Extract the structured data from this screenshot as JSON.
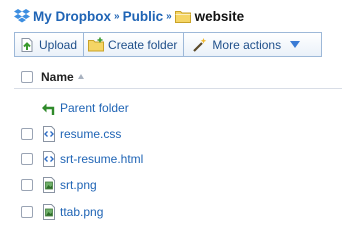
{
  "breadcrumb": {
    "root": "My Dropbox",
    "separator": "»",
    "middle": "Public",
    "current": "website"
  },
  "toolbar": {
    "upload": "Upload",
    "create_folder": "Create folder",
    "more_actions": "More actions"
  },
  "list": {
    "header_name": "Name",
    "parent": "Parent folder",
    "files": [
      {
        "name": "resume.css",
        "icon": "code-file-icon"
      },
      {
        "name": "srt-resume.html",
        "icon": "code-file-icon"
      },
      {
        "name": "srt.png",
        "icon": "image-file-icon"
      },
      {
        "name": "ttab.png",
        "icon": "image-file-icon"
      }
    ]
  },
  "colors": {
    "link": "#1f64b5",
    "button_border": "#9db8d8",
    "folder": "#f2c94c"
  }
}
